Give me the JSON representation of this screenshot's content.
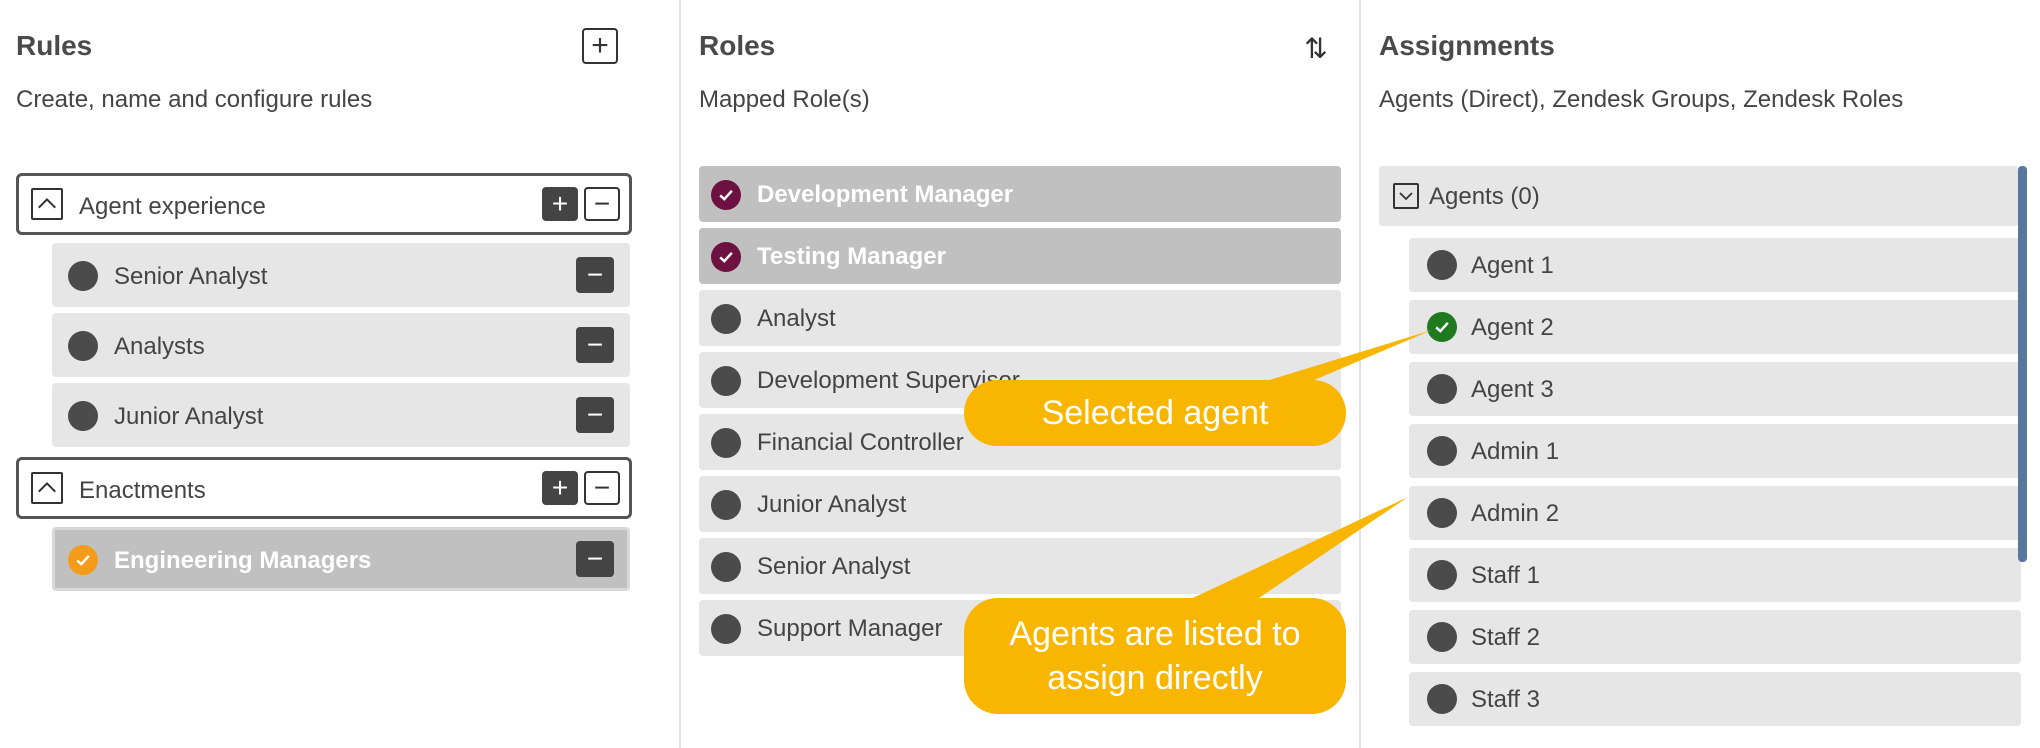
{
  "rules": {
    "title": "Rules",
    "subtitle": "Create, name and configure rules",
    "add_label": "+",
    "groups": [
      {
        "label": "Agent experience",
        "items": [
          "Senior Analyst",
          "Analysts",
          "Junior Analyst"
        ]
      },
      {
        "label": "Enactments",
        "items": [
          "Engineering Managers"
        ],
        "selected": "Engineering Managers"
      }
    ],
    "plus_label": "+",
    "minus_label": "−"
  },
  "roles": {
    "title": "Roles",
    "subtitle": "Mapped Role(s)",
    "sort_label": "⇅",
    "items": [
      {
        "label": "Development Manager",
        "mapped": true
      },
      {
        "label": "Testing Manager",
        "mapped": true
      },
      {
        "label": "Analyst",
        "mapped": false
      },
      {
        "label": "Development Supervisor",
        "mapped": false
      },
      {
        "label": "Financial Controller",
        "mapped": false
      },
      {
        "label": "Junior Analyst",
        "mapped": false
      },
      {
        "label": "Senior Analyst",
        "mapped": false
      },
      {
        "label": "Support Manager",
        "mapped": false
      }
    ]
  },
  "assignments": {
    "title": "Assignments",
    "subtitle": "Agents (Direct), Zendesk Groups, Zendesk Roles",
    "agents_header": "Agents (0)",
    "agents": [
      {
        "label": "Agent 1",
        "selected": false
      },
      {
        "label": "Agent 2",
        "selected": true
      },
      {
        "label": "Agent 3",
        "selected": false
      },
      {
        "label": "Admin 1",
        "selected": false
      },
      {
        "label": "Admin 2",
        "selected": false
      },
      {
        "label": "Staff 1",
        "selected": false
      },
      {
        "label": "Staff 2",
        "selected": false
      },
      {
        "label": "Staff 3",
        "selected": false
      }
    ]
  },
  "callouts": {
    "selected_agent": "Selected agent",
    "agents_listed": "Agents are listed to assign directly"
  },
  "colors": {
    "accent_maroon": "#6d1140",
    "accent_orange": "#f49b1a",
    "accent_green": "#1f7a1f",
    "callout": "#f8b600"
  }
}
